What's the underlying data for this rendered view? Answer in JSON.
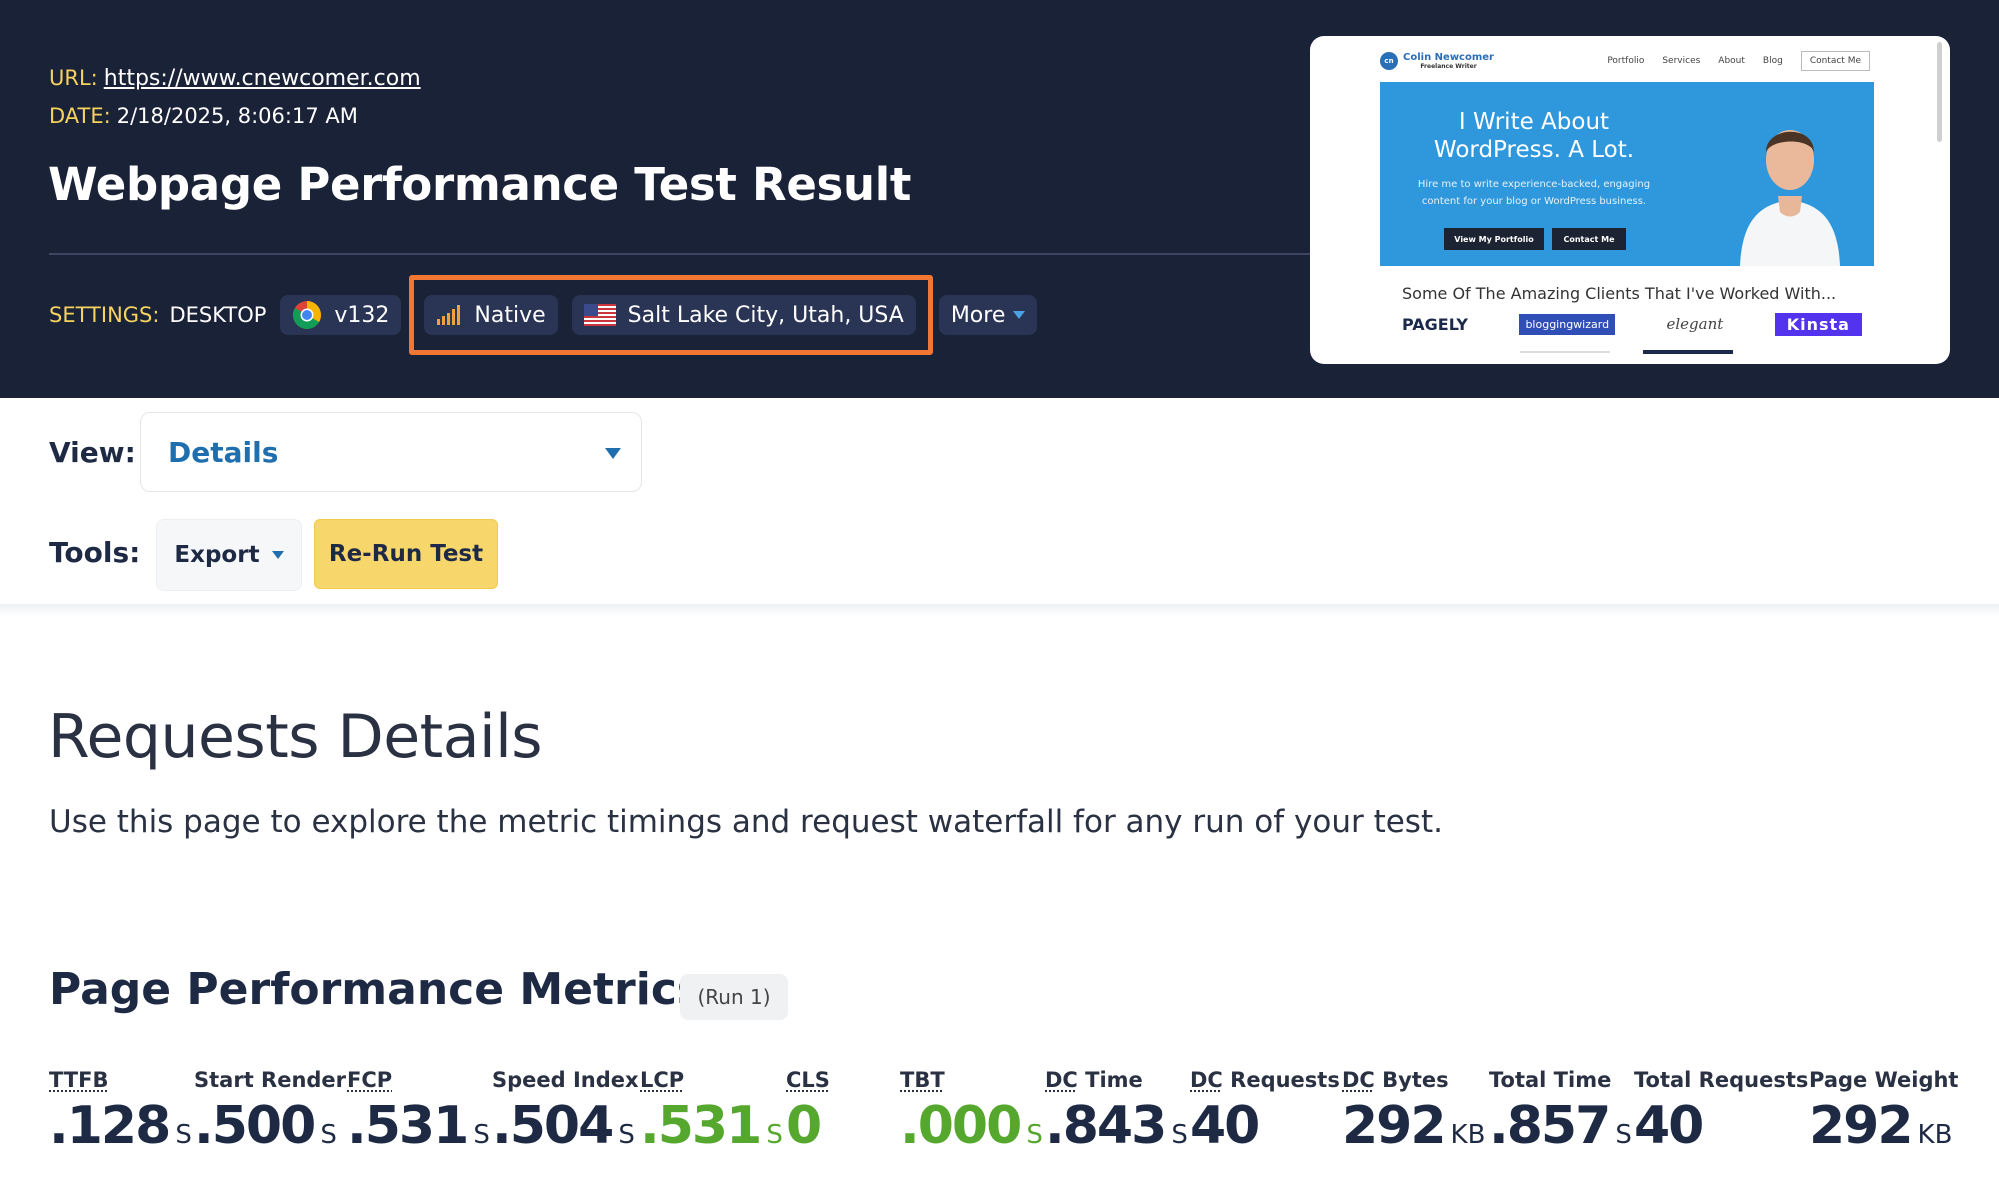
{
  "header": {
    "url_label": "URL:",
    "url": "https://www.cnewcomer.com",
    "date_label": "DATE:",
    "date": "2/18/2025, 8:06:17 AM",
    "title": "Webpage Performance Test Result"
  },
  "settings": {
    "label": "SETTINGS:",
    "device": "DESKTOP",
    "browser_version": "v132",
    "connection": "Native",
    "location": "Salt Lake City, Utah, USA",
    "more": "More"
  },
  "thumbnail": {
    "logo_name": "Colin Newcomer",
    "logo_sub": "Freelance Writer",
    "nav": [
      "Portfolio",
      "Services",
      "About",
      "Blog",
      "Contact Me"
    ],
    "hero_title": "I Write About WordPress. A Lot.",
    "hero_sub": "Hire me to write experience-backed, engaging content for your blog or WordPress business.",
    "btn_portfolio": "View My Portfolio",
    "btn_contact": "Contact Me",
    "clients_heading": "Some Of The Amazing Clients That I've Worked With...",
    "client_logos": [
      "PAGELY",
      "bloggingwizard",
      "elegant",
      "Kinsta"
    ]
  },
  "view": {
    "label": "View:",
    "selected": "Details"
  },
  "tools": {
    "label": "Tools:",
    "export": "Export",
    "rerun": "Re-Run Test"
  },
  "requests": {
    "title": "Requests Details",
    "description": "Use this page to explore the metric timings and request waterfall for any run of your test."
  },
  "metrics": {
    "title": "Page Performance Metrics",
    "run": "(Run 1)",
    "items": [
      {
        "label": "TTFB",
        "value": ".128",
        "unit": "S"
      },
      {
        "label": "Start Render",
        "value": ".500",
        "unit": "S"
      },
      {
        "label": "FCP",
        "value": ".531",
        "unit": "S"
      },
      {
        "label": "Speed Index",
        "value": ".504",
        "unit": "S"
      },
      {
        "label": "LCP",
        "value": ".531",
        "unit": "S"
      },
      {
        "label": "CLS",
        "value": "0",
        "unit": ""
      },
      {
        "label": "TBT",
        "value": ".000",
        "unit": "S"
      },
      {
        "label_abbr": "DC",
        "label": "Time",
        "value": ".843",
        "unit": "S"
      },
      {
        "label_abbr": "DC",
        "label": "Requests",
        "value": "40",
        "unit": ""
      },
      {
        "label_abbr": "DC",
        "label": "Bytes",
        "value": "292",
        "unit": "KB"
      },
      {
        "label": "Total Time",
        "value": ".857",
        "unit": "S"
      },
      {
        "label": "Total Requests",
        "value": "40",
        "unit": ""
      },
      {
        "label": "Page Weight",
        "value": "292",
        "unit": "KB"
      }
    ]
  },
  "colors": {
    "header_bg": "#1a2238",
    "accent_yellow": "#f5d35e",
    "highlight_orange": "#f27733",
    "good_green": "#55a72e",
    "link_blue": "#1f6fae"
  }
}
